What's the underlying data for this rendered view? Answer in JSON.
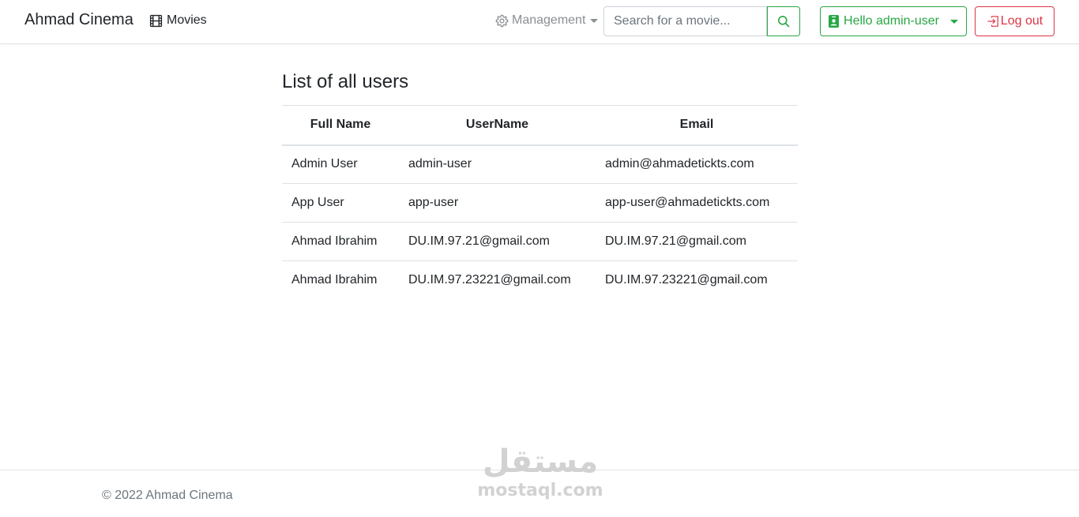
{
  "navbar": {
    "brand": "Ahmad Cinema",
    "movies_label": "Movies",
    "management_label": "Management",
    "search_placeholder": "Search for a movie...",
    "user_menu_label": "Hello admin-user",
    "logout_label": "Log out"
  },
  "main": {
    "title": "List of all users",
    "table": {
      "headers": [
        "Full Name",
        "UserName",
        "Email"
      ],
      "rows": [
        [
          "Admin User",
          "admin-user",
          "admin@ahmadetickts.com"
        ],
        [
          "App User",
          "app-user",
          "app-user@ahmadetickts.com"
        ],
        [
          "Ahmad Ibrahim",
          "DU.IM.97.21@gmail.com",
          "DU.IM.97.21@gmail.com"
        ],
        [
          "Ahmad Ibrahim",
          "DU.IM.97.23221@gmail.com",
          "DU.IM.97.23221@gmail.com"
        ]
      ]
    }
  },
  "footer": {
    "copyright": "© 2022 Ahmad Cinema"
  },
  "watermark": {
    "arabic": "مستقل",
    "latin": "mostaql.com"
  },
  "colors": {
    "success": "#28a745",
    "danger": "#dc3545",
    "muted": "#6c757d",
    "border": "#dee2e6"
  }
}
